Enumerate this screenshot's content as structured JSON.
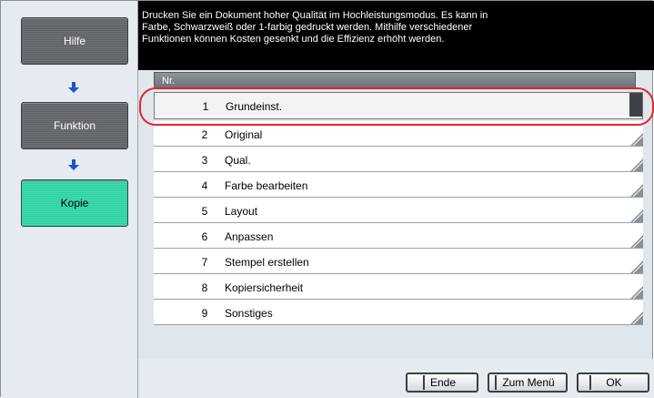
{
  "nav": {
    "help": "Hilfe",
    "function": "Funktion",
    "copy": "Kopie"
  },
  "message": {
    "line1": "Drucken Sie ein Dokument hoher Qualität im Hochleistungsmodus. Es kann in",
    "line2": "Farbe, Schwarzweiß oder 1-farbig gedruckt werden. Mithilfe verschiedener",
    "line3": "Funktionen können Kosten gesenkt und die Effizienz erhöht werden."
  },
  "list": {
    "header": "Nr.",
    "items": [
      {
        "num": "1",
        "label": "Grundeinst."
      },
      {
        "num": "2",
        "label": "Original"
      },
      {
        "num": "3",
        "label": "Qual."
      },
      {
        "num": "4",
        "label": "Farbe bearbeiten"
      },
      {
        "num": "5",
        "label": "Layout"
      },
      {
        "num": "6",
        "label": "Anpassen"
      },
      {
        "num": "7",
        "label": "Stempel erstellen"
      },
      {
        "num": "8",
        "label": "Kopiersicherheit"
      },
      {
        "num": "9",
        "label": "Sonstiges"
      }
    ]
  },
  "buttons": {
    "end": "Ende",
    "menu": "Zum Menü",
    "ok": "OK"
  },
  "colors": {
    "active": "#3edbb0",
    "highlight": "#e2242b"
  },
  "icons": [
    "arrow-down-icon",
    "arrow-down-icon",
    "corner-triangle-icon"
  ]
}
